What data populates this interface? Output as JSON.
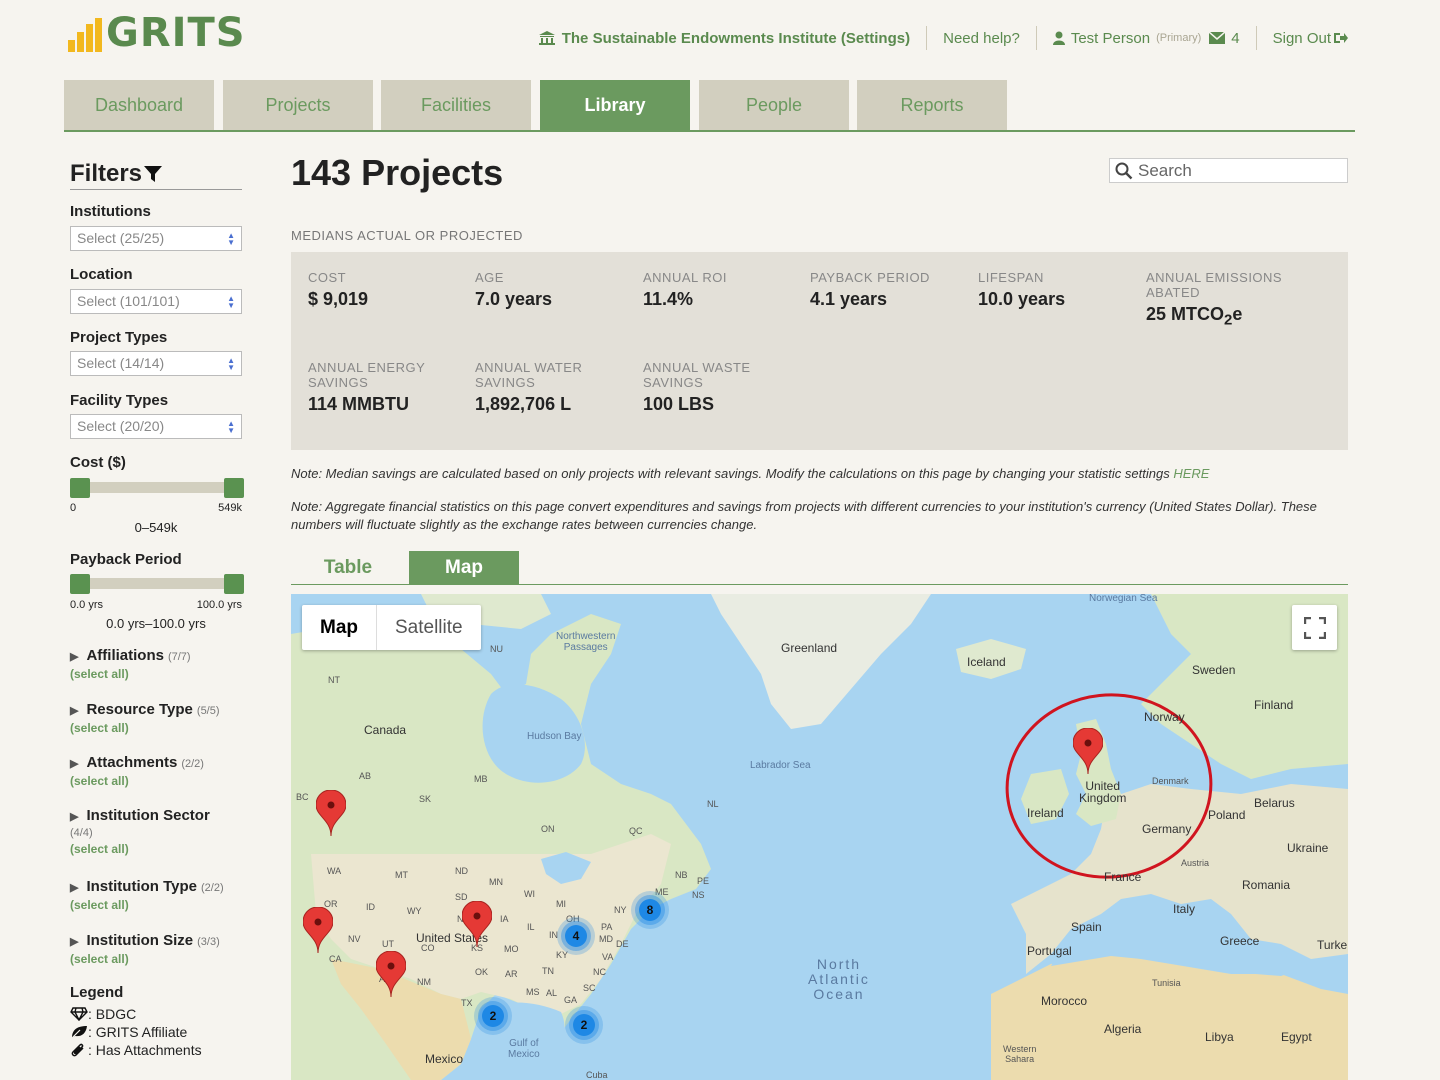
{
  "header": {
    "logo_text": "GRITS",
    "institution": "The Sustainable Endowments Institute (Settings)",
    "help": "Need help?",
    "user": "Test Person",
    "user_role": "(Primary)",
    "messages_count": "4",
    "sign_out": "Sign Out"
  },
  "main_tabs": [
    "Dashboard",
    "Projects",
    "Facilities",
    "Library",
    "People",
    "Reports"
  ],
  "active_tab": "Library",
  "sidebar": {
    "title": "Filters",
    "institutions": {
      "label": "Institutions",
      "value": "Select (25/25)"
    },
    "location": {
      "label": "Location",
      "value": "Select (101/101)"
    },
    "project_types": {
      "label": "Project Types",
      "value": "Select (14/14)"
    },
    "facility_types": {
      "label": "Facility Types",
      "value": "Select (20/20)"
    },
    "cost": {
      "label": "Cost ($)",
      "min": "0",
      "max": "549k",
      "range": "0–549k",
      "low_fraction": 0,
      "high_fraction": 1
    },
    "payback": {
      "label": "Payback Period",
      "min": "0.0 yrs",
      "max": "100.0 yrs",
      "range": "0.0 yrs–100.0 yrs",
      "low_fraction": 0,
      "high_fraction": 1
    },
    "groups": [
      {
        "title": "Affiliations",
        "count": "(7/7)",
        "select_all": "(select all)"
      },
      {
        "title": "Resource Type",
        "count": "(5/5)",
        "select_all": "(select all)"
      },
      {
        "title": "Attachments",
        "count": "(2/2)",
        "select_all": "(select all)"
      },
      {
        "title": "Institution Sector",
        "count": "(4/4)",
        "select_all": "(select all)"
      },
      {
        "title": "Institution Type",
        "count": "(2/2)",
        "select_all": "(select all)"
      },
      {
        "title": "Institution Size",
        "count": "(3/3)",
        "select_all": "(select all)"
      }
    ],
    "legend": {
      "title": "Legend",
      "items": [
        ": BDGC",
        ": GRITS Affiliate",
        ": Has Attachments"
      ]
    }
  },
  "content": {
    "title": "143 Projects",
    "search_placeholder": "Search",
    "medians_title": "MEDIANS ACTUAL OR PROJECTED",
    "stats": [
      {
        "label": "COST",
        "value": "$ 9,019"
      },
      {
        "label": "AGE",
        "value": "7.0 years"
      },
      {
        "label": "ANNUAL ROI",
        "value": "11.4%"
      },
      {
        "label": "PAYBACK PERIOD",
        "value": "4.1 years"
      },
      {
        "label": "LIFESPAN",
        "value": "10.0 years"
      },
      {
        "label": "ANNUAL EMISSIONS ABATED",
        "value": "25 MTCO",
        "value_sub": "2",
        "value_suffix": "e"
      },
      {
        "label": "ANNUAL ENERGY SAVINGS",
        "value": "114 MMBTU"
      },
      {
        "label": "ANNUAL WATER SAVINGS",
        "value": "1,892,706 L"
      },
      {
        "label": "ANNUAL WASTE SAVINGS",
        "value": "100 LBS"
      }
    ],
    "note1": "Note: Median savings are calculated based on only projects with relevant savings. Modify the calculations on this page by changing your statistic settings ",
    "note1_link": "HERE",
    "note2": "Note: Aggregate financial statistics on this page convert expenditures and savings from projects with different currencies to your institution's currency (United States Dollar). These numbers will fluctuate slightly as the exchange rates between currencies change.",
    "view_tabs": [
      "Table",
      "Map"
    ],
    "active_view": "Map"
  },
  "map": {
    "type_buttons": [
      "Map",
      "Satellite"
    ],
    "labels": {
      "norwegian_sea": "Norwegian Sea",
      "nw_passages": "Northwestern\nPassages",
      "greenland": "Greenland",
      "iceland": "Iceland",
      "sweden": "Sweden",
      "finland": "Finland",
      "norway": "Norway",
      "nu": "NU",
      "nt": "NT",
      "canada": "Canada",
      "hudson_bay": "Hudson Bay",
      "labrador_sea": "Labrador Sea",
      "ab": "AB",
      "mb": "MB",
      "bc": "BC",
      "sk": "SK",
      "nl": "NL",
      "on": "ON",
      "qc": "QC",
      "denmark": "Denmark",
      "belarus": "Belarus",
      "ireland": "Ireland",
      "uk": "United\nKingdom",
      "poland": "Poland",
      "germany": "Germany",
      "ukraine": "Ukraine",
      "austria": "Austria",
      "france": "France",
      "romania": "Romania",
      "italy": "Italy",
      "spain": "Spain",
      "portugal": "Portugal",
      "greece": "Greece",
      "turkey": "Turke",
      "morocco": "Morocco",
      "tunisia": "Tunisia",
      "algeria": "Algeria",
      "libya": "Libya",
      "egypt": "Egypt",
      "western_sahara": "Western\nSahara",
      "atlantic": "North\nAtlantic\nOcean",
      "us": "United States",
      "mexico": "Mexico",
      "gulf": "Gulf of\nMexico",
      "cuba": "Cuba",
      "wa": "WA",
      "mt": "MT",
      "nd": "ND",
      "mn": "MN",
      "or": "OR",
      "id": "ID",
      "wy": "WY",
      "sd": "SD",
      "wi": "WI",
      "mi": "MI",
      "ia": "IA",
      "ne": "NE",
      "nv": "NV",
      "ut": "UT",
      "co": "CO",
      "ks": "KS",
      "mo": "MO",
      "il": "IL",
      "in": "IN",
      "oh": "OH",
      "pa": "PA",
      "ny": "NY",
      "ca": "CA",
      "az": "AZ",
      "nm": "NM",
      "ok": "OK",
      "ar": "AR",
      "tn": "TN",
      "ky": "KY",
      "va": "VA",
      "nc": "NC",
      "sc": "SC",
      "tx": "TX",
      "ms": "MS",
      "al": "AL",
      "ga": "GA",
      "me": "ME",
      "nb": "NB",
      "pe": "PE",
      "ns": "NS",
      "md": "MD",
      "de": "DE"
    },
    "clusters": [
      "4",
      "8",
      "2",
      "2"
    ],
    "pin_color": "#e53935",
    "cluster_color": "#1e88e5",
    "highlight_color": "#d0141f"
  }
}
